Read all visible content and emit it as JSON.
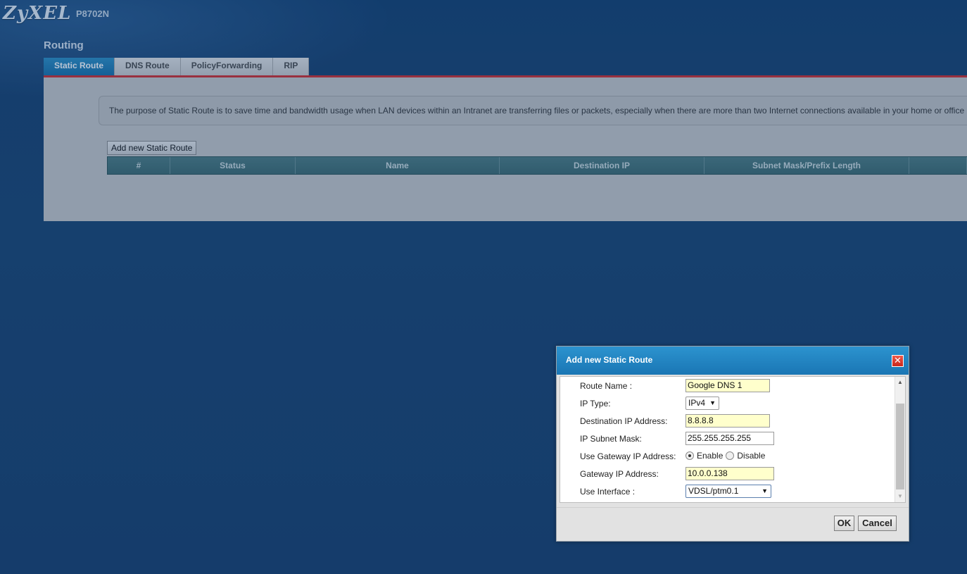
{
  "header": {
    "brand": "ZyXEL",
    "model": "P8702N"
  },
  "page": {
    "title": "Routing",
    "tabs": [
      {
        "label": "Static Route",
        "active": true
      },
      {
        "label": "DNS Route",
        "active": false
      },
      {
        "label": "PolicyForwarding",
        "active": false
      },
      {
        "label": "RIP",
        "active": false
      }
    ],
    "description": "The purpose of Static Route is to save time and bandwidth usage when LAN devices within an Intranet are transferring files or packets, especially when there are more than two Internet connections available in your home or office",
    "add_button": "Add new Static Route",
    "table": {
      "columns": [
        "#",
        "Status",
        "Name",
        "Destination IP",
        "Subnet Mask/Prefix Length",
        ""
      ]
    }
  },
  "dialog": {
    "title": "Add new Static Route",
    "close_symbol": "✕",
    "fields": {
      "route_name": {
        "label": "Route Name :",
        "value": "Google DNS 1"
      },
      "ip_type": {
        "label": "IP Type:",
        "value": "IPv4"
      },
      "destination_ip": {
        "label": "Destination IP Address:",
        "value": "8.8.8.8"
      },
      "subnet_mask": {
        "label": "IP Subnet Mask:",
        "value": "255.255.255.255"
      },
      "use_gateway": {
        "label": "Use Gateway IP Address:",
        "enable": "Enable",
        "disable": "Disable",
        "selected": "Enable"
      },
      "gateway_ip": {
        "label": "Gateway IP Address:",
        "value": "10.0.0.138"
      },
      "use_interface": {
        "label": "Use Interface :",
        "value": "VDSL/ptm0.1"
      }
    },
    "ok_label": "OK",
    "cancel_label": "Cancel"
  },
  "colors": {
    "accent_blue": "#1a76b4",
    "tab_rule_red": "#d32c2c",
    "highlight_field": "#ffffcc"
  }
}
